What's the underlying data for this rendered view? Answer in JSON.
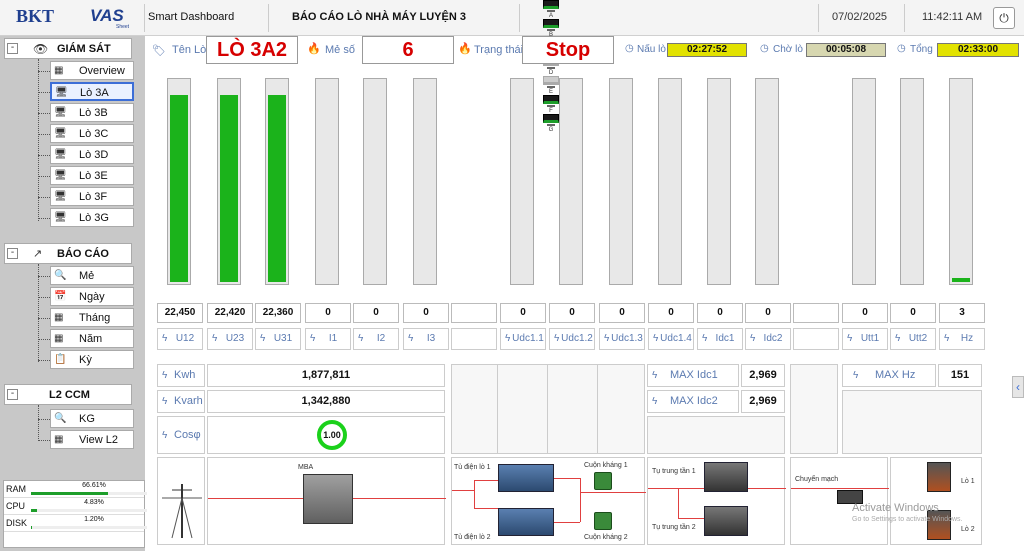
{
  "topbar": {
    "logo_left": "BKT",
    "logo_right": "VAS",
    "logo_right_sub": "Sheet",
    "app_title": "Smart Dashboard",
    "report_title": "BÁO CÁO LÒ NHÀ MÁY LUYỆN 3",
    "stations": [
      {
        "label": "A",
        "state": "on"
      },
      {
        "label": "B",
        "state": "on"
      },
      {
        "label": "C",
        "state": "on"
      },
      {
        "label": "D",
        "state": "off"
      },
      {
        "label": "E",
        "state": "off"
      },
      {
        "label": "F",
        "state": "on"
      },
      {
        "label": "G",
        "state": "on"
      }
    ],
    "date": "07/02/2025",
    "time": "11:42:11 AM",
    "power_icon": "power-icon"
  },
  "sidebar": {
    "monitor": {
      "title": "GIÁM SÁT",
      "items": [
        "Overview",
        "Lò 3A",
        "Lò 3B",
        "Lò 3C",
        "Lò 3D",
        "Lò 3E",
        "Lò 3F",
        "Lò 3G"
      ],
      "active": "Lò 3A"
    },
    "report": {
      "title": "BÁO CÁO",
      "items": [
        "Mẻ",
        "Ngày",
        "Tháng",
        "Năm",
        "Kỳ"
      ]
    },
    "l2": {
      "title": "L2 CCM",
      "items": [
        "KG",
        "View L2"
      ]
    },
    "system": [
      {
        "label": "RAM",
        "value": "66.61%",
        "fraction": 0.6661
      },
      {
        "label": "CPU",
        "value": "4.83%",
        "fraction": 0.0483
      },
      {
        "label": "DISK",
        "value": "1.20%",
        "fraction": 0.012
      }
    ]
  },
  "header": {
    "ten_lo_label": "Tên Lò",
    "ten_lo_value": "LÒ 3A2",
    "me_so_label": "Mẻ số",
    "me_so_value": "6",
    "trang_thai_label": "Trạng thái",
    "trang_thai_value": "Stop",
    "nau_lo_label": "Nấu lò",
    "nau_lo_value": "02:27:52",
    "cho_lo_label": "Chờ lò",
    "cho_lo_value": "00:05:08",
    "tong_label": "Tổng",
    "tong_value": "02:33:00"
  },
  "meters": [
    {
      "label": "U12",
      "value": "22,450",
      "level": 0.92
    },
    {
      "label": "U23",
      "value": "22,420",
      "level": 0.92
    },
    {
      "label": "U31",
      "value": "22,360",
      "level": 0.92
    },
    {
      "label": "I1",
      "value": "0",
      "level": 0
    },
    {
      "label": "I2",
      "value": "0",
      "level": 0
    },
    {
      "label": "I3",
      "value": "0",
      "level": 0
    },
    {
      "label": "Udc1.1",
      "value": "0",
      "level": 0
    },
    {
      "label": "Udc1.2",
      "value": "0",
      "level": 0
    },
    {
      "label": "Udc1.3",
      "value": "0",
      "level": 0
    },
    {
      "label": "Udc1.4",
      "value": "0",
      "level": 0
    },
    {
      "label": "Idc1",
      "value": "0",
      "level": 0
    },
    {
      "label": "Idc2",
      "value": "0",
      "level": 0
    },
    {
      "label": "Utt1",
      "value": "0",
      "level": 0
    },
    {
      "label": "Utt2",
      "value": "0",
      "level": 0
    },
    {
      "label": "Hz",
      "value": "3",
      "level": 0.02
    }
  ],
  "energy": {
    "kwh_label": "Kwh",
    "kwh_value": "1,877,811",
    "kvarh_label": "Kvarh",
    "kvarh_value": "1,342,880",
    "cos_label": "Cosφ",
    "cos_value": "1.00",
    "max_idc1_label": "MAX Idc1",
    "max_idc1_value": "2,969",
    "max_idc2_label": "MAX Idc2",
    "max_idc2_value": "2,969",
    "max_hz_label": "MAX Hz",
    "max_hz_value": "151"
  },
  "diagram": {
    "mba": "MBA",
    "cabinet1": "Tủ điện lò 1",
    "cabinet2": "Tủ điện lò 2",
    "reactor1": "Cuộn kháng 1",
    "reactor2": "Cuộn kháng 2",
    "capacitor1": "Tụ trung tần 1",
    "capacitor2": "Tụ trung tần 2",
    "switch": "Chuyển mạch",
    "furnace1": "Lò 1",
    "furnace2": "Lò 2"
  },
  "watermark": {
    "line1": "Activate Windows",
    "line2": "Go to Settings to activate Windows."
  },
  "colors": {
    "accent": "#3c6ed7",
    "bar_green": "#1bb31b",
    "value_red": "#d60000",
    "timer_yellow": "#e2e200"
  }
}
